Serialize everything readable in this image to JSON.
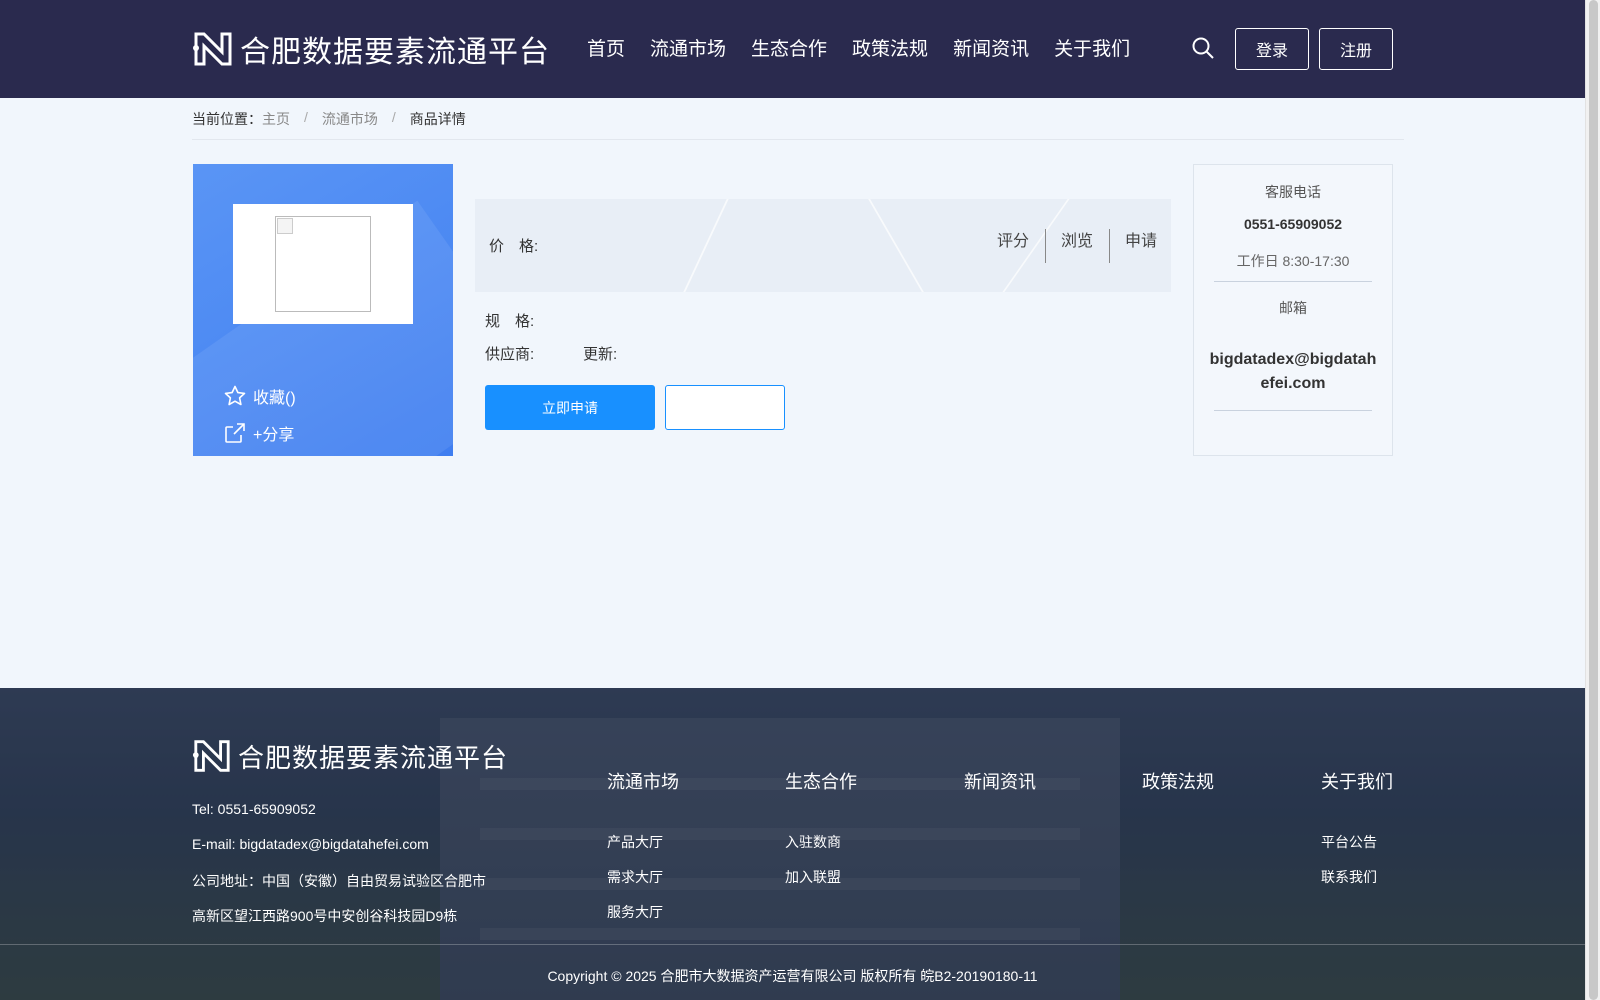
{
  "header": {
    "logo_text": "合肥数据要素流通平台",
    "nav": [
      "首页",
      "流通市场",
      "生态合作",
      "政策法规",
      "新闻资讯",
      "关于我们"
    ],
    "login_label": "登录",
    "register_label": "注册"
  },
  "breadcrumb": {
    "prefix": "当前位置：",
    "items": [
      "主页",
      "流通市场",
      "商品详情"
    ]
  },
  "product": {
    "favorite_label": "收藏()",
    "share_label": "+分享",
    "price_label": "价　格:",
    "stats": [
      "评分",
      "浏览",
      "申请"
    ],
    "spec_label": "规　格:",
    "supplier_label": "供应商:",
    "updated_label": "更新:",
    "apply_label": "立即申请"
  },
  "service": {
    "phone_label": "客服电话",
    "phone": "0551-65909052",
    "hours": "工作日 8:30-17:30",
    "email_label": "邮箱",
    "email": "bigdatadex@bigdatahefei.com"
  },
  "footer": {
    "logo_text": "合肥数据要素流通平台",
    "tel": "Tel: 0551-65909052",
    "email": "E-mail: bigdatadex@bigdatahefei.com",
    "address_1": "公司地址：中国（安徽）自由贸易试验区合肥市",
    "address_2": "高新区望江西路900号中安创谷科技园D9栋",
    "columns": [
      {
        "title": "流通市场",
        "links": [
          "产品大厅",
          "需求大厅",
          "服务大厅"
        ]
      },
      {
        "title": "生态合作",
        "links": [
          "入驻数商",
          "加入联盟"
        ]
      },
      {
        "title": "新闻资讯",
        "links": []
      },
      {
        "title": "政策法规",
        "links": []
      },
      {
        "title": "关于我们",
        "links": [
          "平台公告",
          "联系我们"
        ]
      }
    ],
    "copyright": "Copyright © 2025 合肥市大数据资产运营有限公司 版权所有 皖B2-20190180-11"
  }
}
